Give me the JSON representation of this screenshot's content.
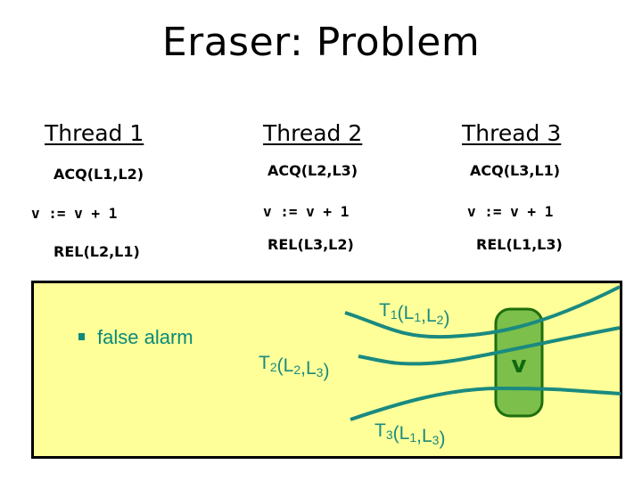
{
  "title": "Eraser: Problem",
  "threads": [
    {
      "heading": "Thread 1",
      "acquire": "ACQ(L1,L2)",
      "update": "v := v + 1",
      "release": "REL(L2,L1)"
    },
    {
      "heading": "Thread 2",
      "acquire": "ACQ(L2,L3)",
      "update": "v := v + 1",
      "release": "REL(L3,L2)"
    },
    {
      "heading": "Thread 3",
      "acquire": "ACQ(L3,L1)",
      "update": "v := v + 1",
      "release": "REL(L1,L3)"
    }
  ],
  "panel": {
    "bullet": "false alarm",
    "variable_label": "v",
    "paths": [
      {
        "thread": "T",
        "thread_sub": "1",
        "locks": [
          {
            "name": "L",
            "sub": "1"
          },
          {
            "name": "L",
            "sub": "2"
          }
        ]
      },
      {
        "thread": "T",
        "thread_sub": "2",
        "locks": [
          {
            "name": "L",
            "sub": "2"
          },
          {
            "name": "L",
            "sub": "3"
          }
        ]
      },
      {
        "thread": "T",
        "thread_sub": "3",
        "locks": [
          {
            "name": "L",
            "sub": "1"
          },
          {
            "name": "L",
            "sub": "3"
          }
        ]
      }
    ],
    "colors": {
      "panel_bg": "#ffff99",
      "path_color": "#1a8a80",
      "variable_fill": "#7cbf4a",
      "variable_stroke": "#1f6e0e",
      "variable_text": "#0f6a10"
    }
  }
}
